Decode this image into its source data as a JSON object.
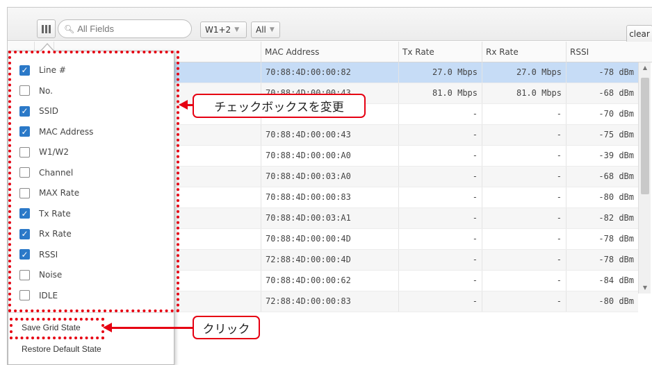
{
  "toolbar": {
    "search_placeholder": "All Fields",
    "filter_wlan": "W1+2",
    "filter_scope": "All",
    "clear_label": "clear"
  },
  "columns": {
    "mac": "MAC Address",
    "tx": "Tx Rate",
    "rx": "Rx Rate",
    "rssi": "RSSI"
  },
  "rows": [
    {
      "mac": "70:88:4D:00:00:82",
      "tx": "27.0 Mbps",
      "rx": "27.0 Mbps",
      "rssi": "-78 dBm",
      "selected": true
    },
    {
      "mac": "70:88:4D:00:00:43",
      "tx": "81.0 Mbps",
      "rx": "81.0 Mbps",
      "rssi": "-68 dBm"
    },
    {
      "mac": "",
      "tx": "-",
      "rx": "-",
      "rssi": "-70 dBm"
    },
    {
      "mac": "70:88:4D:00:00:43",
      "tx": "-",
      "rx": "-",
      "rssi": "-75 dBm"
    },
    {
      "mac": "70:88:4D:00:00:A0",
      "tx": "-",
      "rx": "-",
      "rssi": "-39 dBm"
    },
    {
      "mac": "70:88:4D:00:03:A0",
      "tx": "-",
      "rx": "-",
      "rssi": "-68 dBm"
    },
    {
      "mac": "70:88:4D:00:00:83",
      "tx": "-",
      "rx": "-",
      "rssi": "-80 dBm"
    },
    {
      "mac": "70:88:4D:00:03:A1",
      "tx": "-",
      "rx": "-",
      "rssi": "-82 dBm"
    },
    {
      "mac": "70:88:4D:00:00:4D",
      "tx": "-",
      "rx": "-",
      "rssi": "-78 dBm"
    },
    {
      "mac": "72:88:4D:00:00:4D",
      "tx": "-",
      "rx": "-",
      "rssi": "-78 dBm"
    },
    {
      "mac": "70:88:4D:00:00:62",
      "tx": "-",
      "rx": "-",
      "rssi": "-84 dBm"
    },
    {
      "mac": "72:88:4D:00:00:83",
      "tx": "-",
      "rx": "-",
      "rssi": "-80 dBm"
    }
  ],
  "menu": {
    "items": [
      {
        "label": "Line #",
        "checked": true
      },
      {
        "label": "No.",
        "checked": false
      },
      {
        "label": "SSID",
        "checked": true
      },
      {
        "label": "MAC Address",
        "checked": true
      },
      {
        "label": "W1/W2",
        "checked": false
      },
      {
        "label": "Channel",
        "checked": false
      },
      {
        "label": "MAX Rate",
        "checked": false
      },
      {
        "label": "Tx Rate",
        "checked": true
      },
      {
        "label": "Rx Rate",
        "checked": true
      },
      {
        "label": "RSSI",
        "checked": true
      },
      {
        "label": "Noise",
        "checked": false
      },
      {
        "label": "IDLE",
        "checked": false
      }
    ],
    "save_label": "Save Grid State",
    "restore_label": "Restore Default State"
  },
  "annotations": {
    "checkbox_callout": "チェックボックスを変更",
    "click_callout": "クリック"
  },
  "colors": {
    "accent": "#e60012",
    "checkbox_checked": "#2b79c8",
    "row_selected": "#c6dcf6"
  },
  "icons": {
    "columns_button": "columns-icon",
    "search": "search-icon",
    "dropdown": "chevron-down-icon",
    "scroll_up": "scroll-up-icon",
    "scroll_down": "scroll-down-icon"
  }
}
